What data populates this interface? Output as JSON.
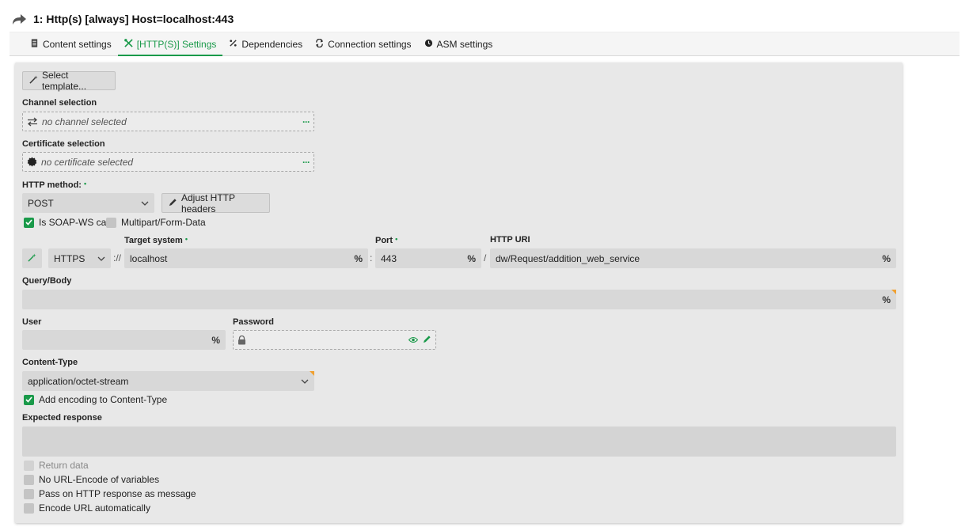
{
  "header": {
    "title": "1: Http(s) [always] Host=localhost:443"
  },
  "tabs": [
    {
      "label": "Content settings",
      "icon": "document-icon"
    },
    {
      "label": "[HTTP(S)] Settings",
      "icon": "tools-icon"
    },
    {
      "label": "Dependencies",
      "icon": "percent-icon"
    },
    {
      "label": "Connection settings",
      "icon": "sync-icon"
    },
    {
      "label": "ASM settings",
      "icon": "asm-icon"
    }
  ],
  "form": {
    "select_template_label": "Select template...",
    "channel": {
      "label": "Channel selection",
      "placeholder": "no channel selected",
      "more": "···"
    },
    "certificate": {
      "label": "Certificate selection",
      "placeholder": "no certificate selected",
      "more": "···"
    },
    "http_method": {
      "label": "HTTP method:",
      "required": "•",
      "value": "POST"
    },
    "adjust_headers_label": "Adjust HTTP headers",
    "is_soap": {
      "label": "Is SOAP-WS call",
      "checked": true
    },
    "multipart": {
      "label": "Multipart/Form-Data",
      "checked": false
    },
    "protocol": {
      "value": "HTTPS",
      "separator": "://"
    },
    "target_system": {
      "label": "Target system",
      "required": "•",
      "value": "localhost"
    },
    "port": {
      "label": "Port",
      "required": "•",
      "value": "443",
      "separator": ":"
    },
    "http_uri": {
      "label": "HTTP URI",
      "value": "dw/Request/addition_web_service",
      "separator": "/"
    },
    "query_body": {
      "label": "Query/Body",
      "value": ""
    },
    "user": {
      "label": "User",
      "value": ""
    },
    "password": {
      "label": "Password",
      "value": ""
    },
    "content_type": {
      "label": "Content-Type",
      "value": "application/octet-stream"
    },
    "add_encoding": {
      "label": "Add encoding to Content-Type",
      "checked": true
    },
    "expected_response": {
      "label": "Expected response",
      "value": ""
    },
    "options": [
      {
        "label": "Return data",
        "checked": false,
        "disabled": true
      },
      {
        "label": "No URL-Encode of variables",
        "checked": false
      },
      {
        "label": "Pass on HTTP response as message",
        "checked": false
      },
      {
        "label": "Encode URL automatically",
        "checked": false
      }
    ],
    "variable_marker": "%"
  },
  "colors": {
    "accent": "#1a9a4a",
    "panel": "#e8e8e8",
    "field": "#d8d8d8",
    "marker": "#f0a030"
  }
}
